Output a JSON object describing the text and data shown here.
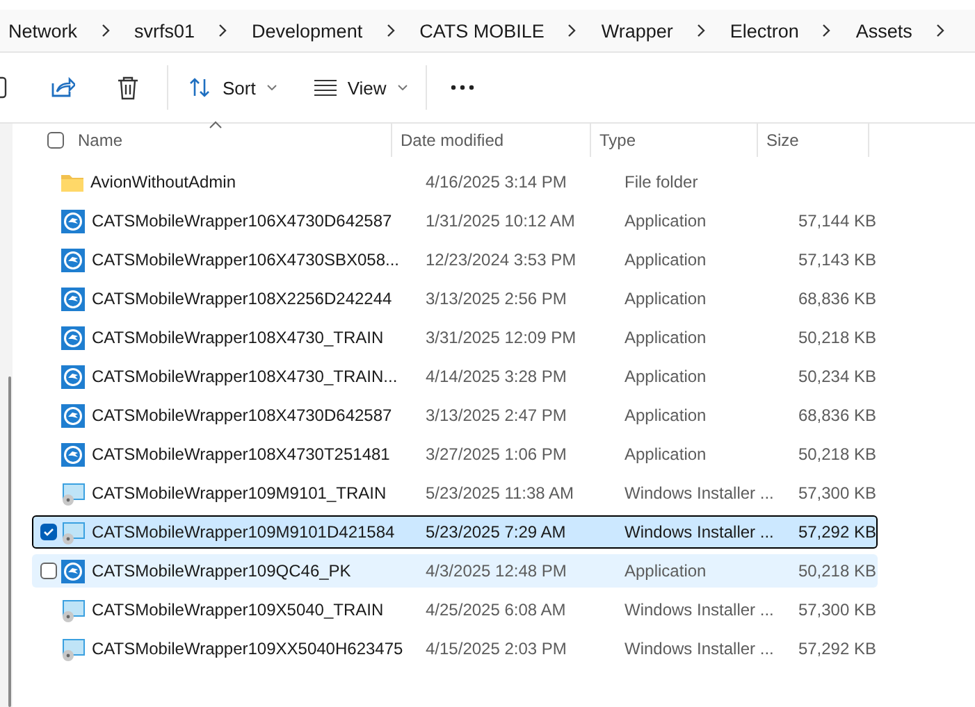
{
  "breadcrumb": [
    "Network",
    "svrfs01",
    "Development",
    "CATS MOBILE",
    "Wrapper",
    "Electron",
    "Assets"
  ],
  "toolbar": {
    "sort": "Sort",
    "view": "View"
  },
  "table": {
    "select_all_checked": false,
    "columns": [
      {
        "label": "Name",
        "sorted": true
      },
      {
        "label": "Date modified",
        "sorted": false
      },
      {
        "label": "Type",
        "sorted": false
      },
      {
        "label": "Size",
        "sorted": false
      }
    ],
    "rows": [
      {
        "kind": "folder",
        "name": "AvionWithoutAdmin",
        "date": "4/16/2025 3:14 PM",
        "type": "File folder",
        "size": "",
        "selected": false,
        "hovered": false
      },
      {
        "kind": "app",
        "name": "CATSMobileWrapper106X4730D642587",
        "date": "1/31/2025 10:12 AM",
        "type": "Application",
        "size": "57,144 KB",
        "selected": false,
        "hovered": false
      },
      {
        "kind": "app",
        "name": "CATSMobileWrapper106X4730SBX058...",
        "date": "12/23/2024 3:53 PM",
        "type": "Application",
        "size": "57,143 KB",
        "selected": false,
        "hovered": false
      },
      {
        "kind": "app",
        "name": "CATSMobileWrapper108X2256D242244",
        "date": "3/13/2025 2:56 PM",
        "type": "Application",
        "size": "68,836 KB",
        "selected": false,
        "hovered": false
      },
      {
        "kind": "app",
        "name": "CATSMobileWrapper108X4730_TRAIN",
        "date": "3/31/2025 12:09 PM",
        "type": "Application",
        "size": "50,218 KB",
        "selected": false,
        "hovered": false
      },
      {
        "kind": "app",
        "name": "CATSMobileWrapper108X4730_TRAIN...",
        "date": "4/14/2025 3:28 PM",
        "type": "Application",
        "size": "50,234 KB",
        "selected": false,
        "hovered": false
      },
      {
        "kind": "app",
        "name": "CATSMobileWrapper108X4730D642587",
        "date": "3/13/2025 2:47 PM",
        "type": "Application",
        "size": "68,836 KB",
        "selected": false,
        "hovered": false
      },
      {
        "kind": "app",
        "name": "CATSMobileWrapper108X4730T251481",
        "date": "3/27/2025 1:06 PM",
        "type": "Application",
        "size": "50,218 KB",
        "selected": false,
        "hovered": false
      },
      {
        "kind": "installer",
        "name": "CATSMobileWrapper109M9101_TRAIN",
        "date": "5/23/2025 11:38 AM",
        "type": "Windows Installer ...",
        "size": "57,300 KB",
        "selected": false,
        "hovered": false
      },
      {
        "kind": "installer",
        "name": "CATSMobileWrapper109M9101D421584",
        "date": "5/23/2025 7:29 AM",
        "type": "Windows Installer ...",
        "size": "57,292 KB",
        "selected": true,
        "hovered": false
      },
      {
        "kind": "app",
        "name": "CATSMobileWrapper109QC46_PK",
        "date": "4/3/2025 12:48 PM",
        "type": "Application",
        "size": "50,218 KB",
        "selected": false,
        "hovered": true
      },
      {
        "kind": "installer",
        "name": "CATSMobileWrapper109X5040_TRAIN",
        "date": "4/25/2025 6:08 AM",
        "type": "Windows Installer ...",
        "size": "57,300 KB",
        "selected": false,
        "hovered": false
      },
      {
        "kind": "installer",
        "name": "CATSMobileWrapper109XX5040H623475",
        "date": "4/15/2025 2:03 PM",
        "type": "Windows Installer ...",
        "size": "57,292 KB",
        "selected": false,
        "hovered": false
      }
    ]
  }
}
